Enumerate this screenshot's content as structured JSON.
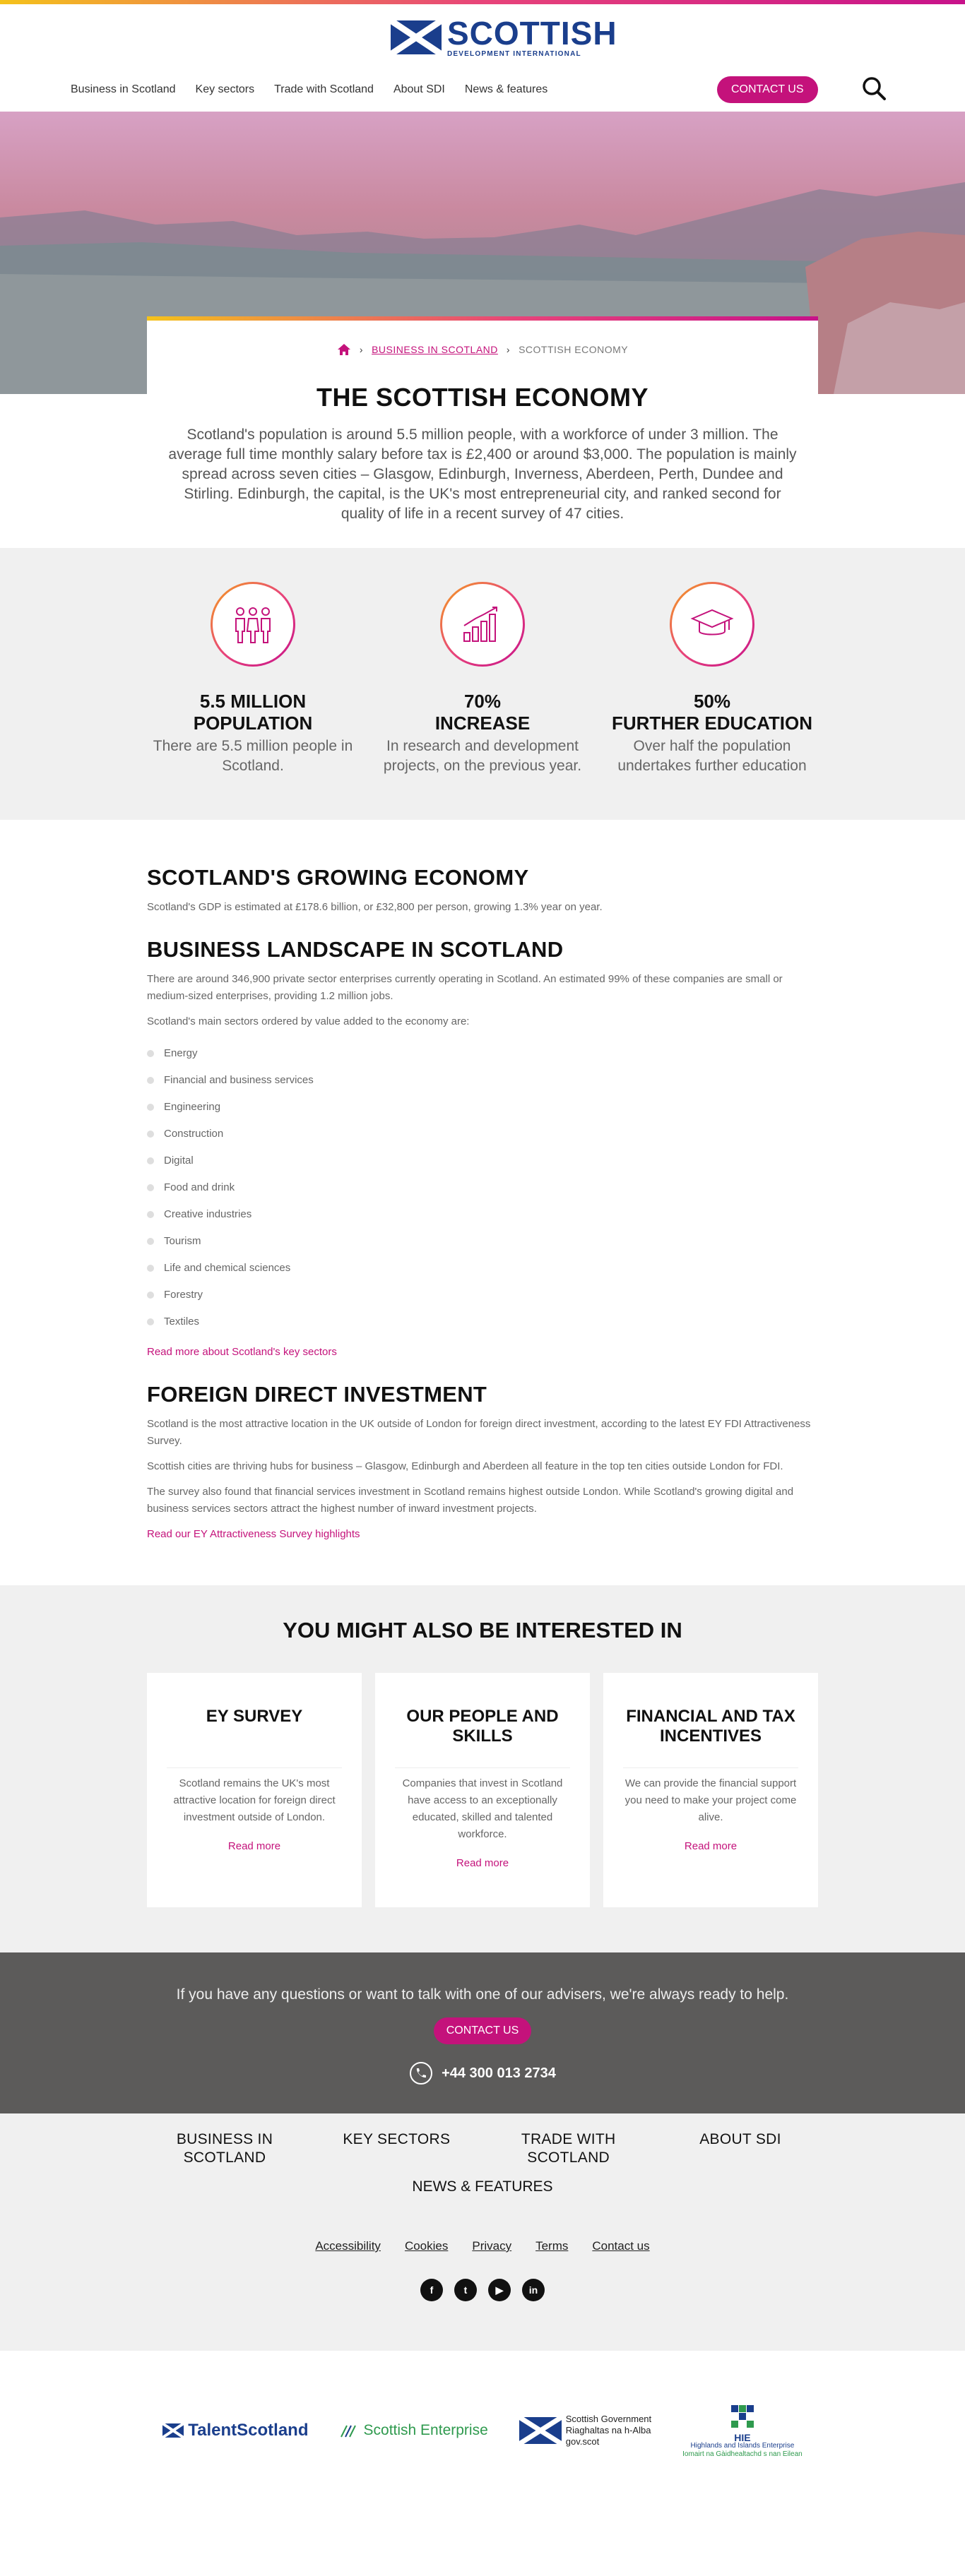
{
  "header": {
    "logo_main": "SCOTTISH",
    "logo_sub": "DEVELOPMENT INTERNATIONAL",
    "nav": [
      "Business in Scotland",
      "Key sectors",
      "Trade with Scotland",
      "About SDI",
      "News & features"
    ],
    "contact_label": "CONTACT US"
  },
  "breadcrumb": {
    "parent": "BUSINESS IN SCOTLAND",
    "current": "SCOTTISH ECONOMY"
  },
  "intro": {
    "title": "THE SCOTTISH ECONOMY",
    "text": "Scotland's population is around 5.5 million people, with a workforce of under 3 million. The average full time monthly salary before tax is £2,400 or around $3,000. The population is mainly spread across seven cities – Glasgow, Edinburgh, Inverness, Aberdeen, Perth, Dundee and Stirling. Edinburgh, the capital, is the UK's most entrepreneurial city, and ranked second for quality of life in a recent survey of 47 cities."
  },
  "stats": [
    {
      "icon": "people-icon",
      "value": "5.5 MILLION",
      "label": "POPULATION",
      "desc": "There are 5.5 million people in Scotland."
    },
    {
      "icon": "growth-chart-icon",
      "value": "70%",
      "label": "INCREASE",
      "desc": "In research and development projects, on the previous year."
    },
    {
      "icon": "graduation-cap-icon",
      "value": "50%",
      "label": "FURTHER EDUCATION",
      "desc": "Over half the population undertakes further education"
    }
  ],
  "economy": {
    "title": "SCOTLAND'S GROWING ECONOMY",
    "text": "Scotland's GDP is estimated at £178.6 billion, or £32,800 per person, growing 1.3% year on year."
  },
  "landscape": {
    "title": "BUSINESS LANDSCAPE IN SCOTLAND",
    "text1": "There are around 346,900 private sector enterprises currently operating in Scotland. An estimated 99% of these companies are small or medium-sized enterprises, providing 1.2 million jobs.",
    "text2": "Scotland's main sectors ordered by value added to the economy are:",
    "sectors": [
      "Energy",
      "Financial and business services",
      "Engineering",
      "Construction",
      "Digital",
      "Food and drink",
      "Creative industries",
      "Tourism",
      "Life and chemical sciences",
      "Forestry",
      "Textiles"
    ],
    "link": "Read more about Scotland's key sectors"
  },
  "fdi": {
    "title": "FOREIGN DIRECT INVESTMENT",
    "p1": "Scotland is the most attractive location in the UK outside of London for foreign direct investment, according to the latest EY FDI Attractiveness Survey.",
    "p2": "Scottish cities are thriving hubs for business – Glasgow, Edinburgh and Aberdeen all feature in the top ten cities outside London for FDI.",
    "p3": "The survey also found that financial services investment in Scotland remains highest outside London. While Scotland's growing digital and business services sectors attract the highest number of inward investment projects.",
    "link": "Read our EY Attractiveness Survey highlights"
  },
  "interest": {
    "title": "YOU MIGHT ALSO BE INTERESTED IN",
    "cards": [
      {
        "title": "EY SURVEY",
        "text": "Scotland remains the UK's most attractive location for foreign direct investment outside of London.",
        "link": "Read more"
      },
      {
        "title": "OUR PEOPLE AND SKILLS",
        "text": "Companies that invest in Scotland have access to an exceptionally educated, skilled and talented workforce.",
        "link": "Read more"
      },
      {
        "title": "FINANCIAL AND TAX INCENTIVES",
        "text": "We can provide the financial support you need to make your project come alive.",
        "link": "Read more"
      }
    ]
  },
  "cta": {
    "text": "If you have any questions or want to talk with one of our advisers, we're always ready to help.",
    "button": "CONTACT US",
    "phone": "+44 300 013 2734"
  },
  "footer": {
    "nav": [
      "BUSINESS IN SCOTLAND",
      "KEY SECTORS",
      "TRADE WITH SCOTLAND",
      "ABOUT SDI"
    ],
    "nav2": "NEWS & FEATURES",
    "legal": [
      "Accessibility",
      "Cookies",
      "Privacy",
      "Terms",
      "Contact us"
    ],
    "social": [
      "facebook-icon",
      "twitter-icon",
      "youtube-icon",
      "linkedin-icon"
    ]
  },
  "partners": {
    "talent": "TalentScotland",
    "enterprise": "Scottish Enterprise",
    "gov_line1": "Scottish Government",
    "gov_line2": "Riaghaltas na h-Alba",
    "gov_line3": "gov.scot",
    "hie_line1": "HIE",
    "hie_line2": "Highlands and Islands Enterprise",
    "hie_line3": "Iomairt na Gàidhealtachd s nan Eilean"
  },
  "colors": {
    "accent": "#c4127b",
    "brand_blue": "#1a3e8c",
    "footer_dark": "#5c5b5a",
    "section_grey": "#f0f0f0"
  }
}
